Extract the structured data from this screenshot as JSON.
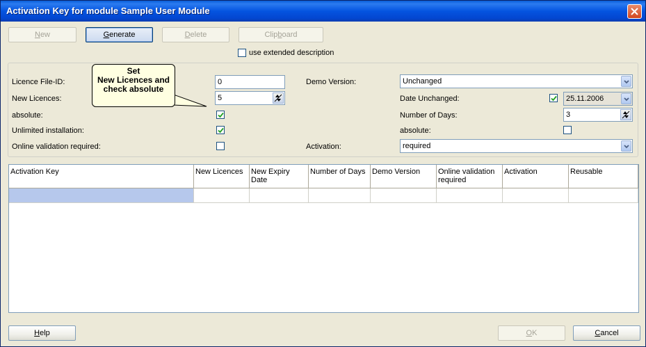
{
  "window": {
    "title": "Activation Key for module Sample User Module"
  },
  "toolbar": {
    "new_label": "New",
    "new_access": "N",
    "generate_label": "Generate",
    "generate_access": "G",
    "delete_label": "Delete",
    "delete_access": "D",
    "clipboard_label": "Clipboard",
    "clipboard_access": "b"
  },
  "extended": {
    "label": "use extended description",
    "checked": false
  },
  "tooltip": {
    "lines": [
      "Set",
      "New Licences and",
      "check absolute"
    ]
  },
  "form": {
    "licence_file_id_label": "Licence File-ID:",
    "licence_file_id_value": "0",
    "new_licences_label": "New Licences:",
    "new_licences_value": "5",
    "absolute_label": "absolute:",
    "unlimited_label": "Unlimited installation:",
    "online_label": "Online validation required:",
    "demo_version_label": "Demo Version:",
    "demo_version_value": "Unchanged",
    "date_unchanged_label": "Date Unchanged:",
    "date_value": "25.11.2006",
    "number_of_days_label": "Number of Days:",
    "number_of_days_value": "3",
    "absolute_right_label": "absolute:",
    "activation_label": "Activation:",
    "activation_value": "required"
  },
  "grid": {
    "headers": [
      "Activation Key",
      "New Licences",
      "New Expiry Date",
      "Number of Days",
      "Demo Version",
      "Online validation required",
      "Activation",
      "Reusable"
    ]
  },
  "footer": {
    "help_label": "Help",
    "help_access": "H",
    "ok_label": "OK",
    "ok_access": "O",
    "cancel_label": "Cancel",
    "cancel_access": "C"
  },
  "colors": {
    "title_bar": "#0454e0",
    "dialog_bg": "#ece9d8",
    "selected_cell": "#b6c8ec"
  }
}
